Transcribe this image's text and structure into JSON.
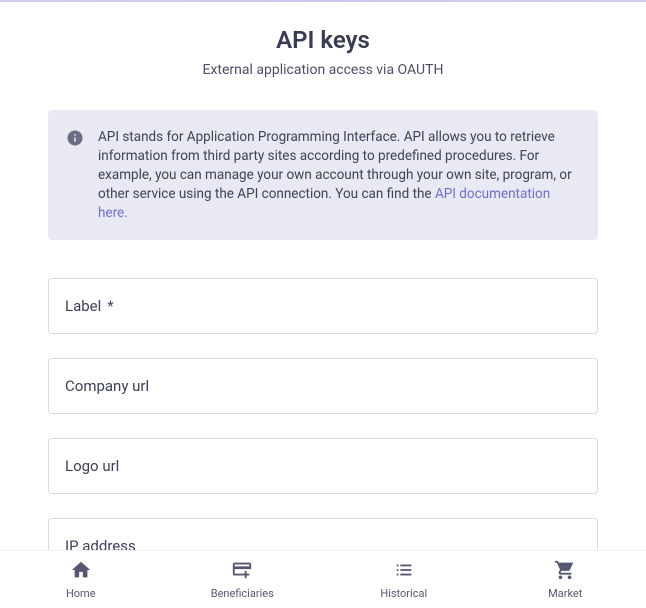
{
  "header": {
    "title": "API keys",
    "subtitle": "External application access via OAUTH"
  },
  "info": {
    "text": "API stands for Application Programming Interface. API allows you to retrieve information from third party sites according to predefined procedures. For example, you can manage your own account through your own site, program, or other service using the API connection. You can find the ",
    "link_text": "API documentation here."
  },
  "fields": {
    "label": {
      "label": "Label",
      "required": "*"
    },
    "company_url": {
      "label": "Company url"
    },
    "logo_url": {
      "label": "Logo url"
    },
    "ip_address": {
      "label": "IP address"
    }
  },
  "nav": {
    "home": "Home",
    "beneficiaries": "Beneficiaries",
    "historical": "Historical",
    "market": "Market"
  }
}
